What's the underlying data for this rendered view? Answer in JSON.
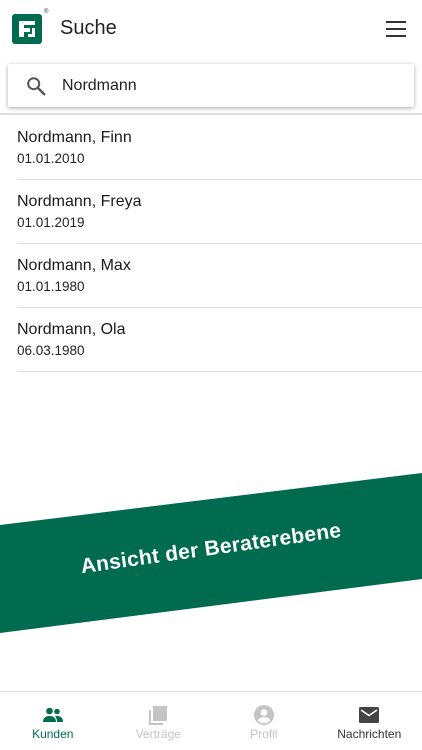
{
  "header": {
    "title": "Suche",
    "logo_reg_mark": "®",
    "brand_color": "#006b4f",
    "logo_icon": "brand-logo-icon",
    "menu_icon": "hamburger-menu-icon"
  },
  "search": {
    "value": "Nordmann",
    "icon": "search-icon"
  },
  "results": [
    {
      "name": "Nordmann, Finn",
      "date": "01.01.2010"
    },
    {
      "name": "Nordmann, Freya",
      "date": "01.01.2019"
    },
    {
      "name": "Nordmann, Max",
      "date": "01.01.1980"
    },
    {
      "name": "Nordmann, Ola",
      "date": "06.03.1980"
    }
  ],
  "banner": {
    "text": "Ansicht der Beraterebene",
    "color": "#006b4f"
  },
  "bottom_nav": {
    "items": [
      {
        "label": "Kunden",
        "icon": "people-icon",
        "state": "active"
      },
      {
        "label": "Verträge",
        "icon": "documents-icon",
        "state": "disabled"
      },
      {
        "label": "Profil",
        "icon": "account-circle-icon",
        "state": "disabled"
      },
      {
        "label": "Nachrichten",
        "icon": "envelope-icon",
        "state": "normal"
      }
    ]
  }
}
